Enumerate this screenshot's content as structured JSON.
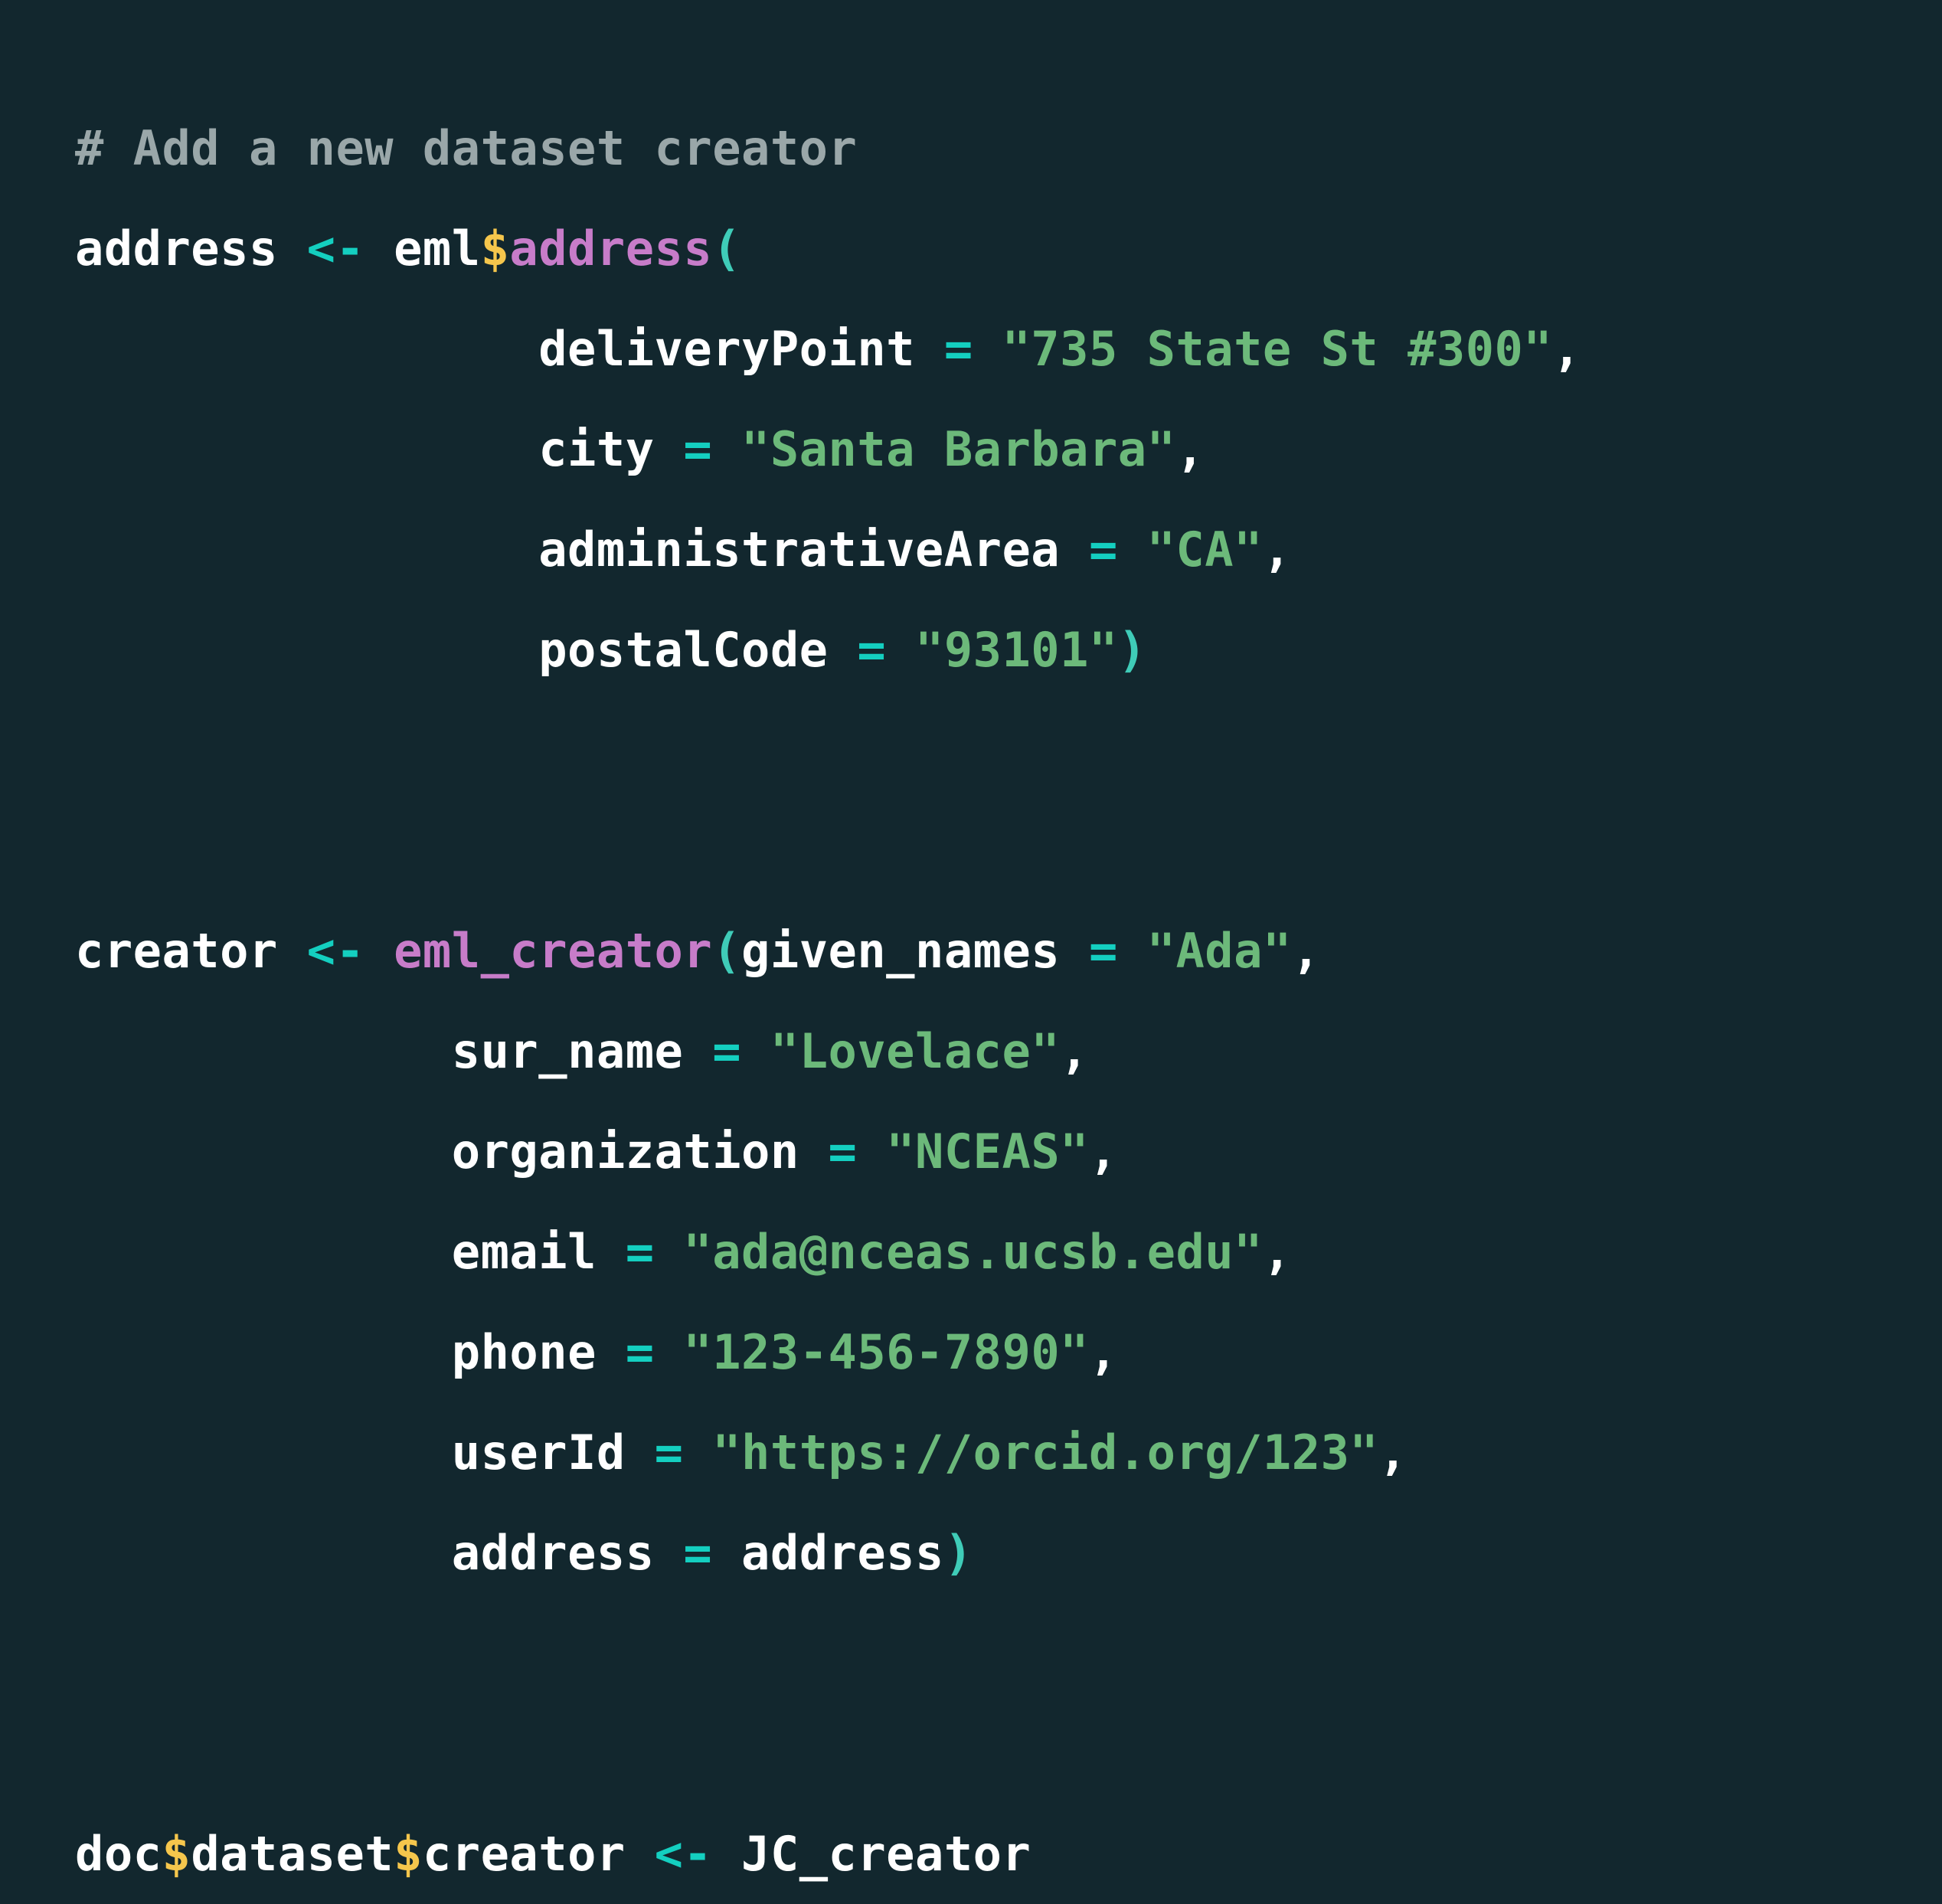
{
  "editor": {
    "language": "R",
    "background_color": "#12272e",
    "theme_name": "dark",
    "colors": {
      "comment": "#9aa7a9",
      "variable": "#ffffff",
      "assign_operator": "#14cfc0",
      "equals_operator": "#14cfc0",
      "dollar_operator": "#f5c64c",
      "function_name": "#c77cc9",
      "parenthesis": "#3fccb8",
      "string": "#6cb97a",
      "punctuation": "#ffffff"
    }
  },
  "code": {
    "lines": [
      {
        "id": "line-1",
        "kind": "comment",
        "text": "# Add a new dataset creator",
        "tokens": [
          {
            "t": "# Add a new dataset creator",
            "c": "comment"
          }
        ]
      },
      {
        "id": "line-2",
        "kind": "assignment",
        "text": "address <- eml$address(",
        "tokens": [
          {
            "t": "address",
            "c": "var"
          },
          {
            "t": " ",
            "c": "plain"
          },
          {
            "t": "<-",
            "c": "assign"
          },
          {
            "t": " ",
            "c": "plain"
          },
          {
            "t": "eml",
            "c": "var"
          },
          {
            "t": "$",
            "c": "dollar"
          },
          {
            "t": "address",
            "c": "func"
          },
          {
            "t": "(",
            "c": "paren"
          }
        ]
      },
      {
        "id": "line-3",
        "kind": "argument",
        "text": "                deliveryPoint = \"735 State St #300\",",
        "tokens": [
          {
            "t": "                ",
            "c": "plain"
          },
          {
            "t": "deliveryPoint",
            "c": "arg"
          },
          {
            "t": " ",
            "c": "plain"
          },
          {
            "t": "=",
            "c": "eq"
          },
          {
            "t": " ",
            "c": "plain"
          },
          {
            "t": "\"735 State St #300\"",
            "c": "string"
          },
          {
            "t": ",",
            "c": "punct"
          }
        ]
      },
      {
        "id": "line-4",
        "kind": "argument",
        "text": "                city = \"Santa Barbara\",",
        "tokens": [
          {
            "t": "                ",
            "c": "plain"
          },
          {
            "t": "city",
            "c": "arg"
          },
          {
            "t": " ",
            "c": "plain"
          },
          {
            "t": "=",
            "c": "eq"
          },
          {
            "t": " ",
            "c": "plain"
          },
          {
            "t": "\"Santa Barbara\"",
            "c": "string"
          },
          {
            "t": ",",
            "c": "punct"
          }
        ]
      },
      {
        "id": "line-5",
        "kind": "argument",
        "text": "                administrativeArea = \"CA\",",
        "tokens": [
          {
            "t": "                ",
            "c": "plain"
          },
          {
            "t": "administrativeArea",
            "c": "arg"
          },
          {
            "t": " ",
            "c": "plain"
          },
          {
            "t": "=",
            "c": "eq"
          },
          {
            "t": " ",
            "c": "plain"
          },
          {
            "t": "\"CA\"",
            "c": "string"
          },
          {
            "t": ",",
            "c": "punct"
          }
        ]
      },
      {
        "id": "line-6",
        "kind": "argument",
        "text": "                postalCode = \"93101\")",
        "tokens": [
          {
            "t": "                ",
            "c": "plain"
          },
          {
            "t": "postalCode",
            "c": "arg"
          },
          {
            "t": " ",
            "c": "plain"
          },
          {
            "t": "=",
            "c": "eq"
          },
          {
            "t": " ",
            "c": "plain"
          },
          {
            "t": "\"93101\"",
            "c": "string"
          },
          {
            "t": ")",
            "c": "paren"
          }
        ]
      },
      {
        "id": "line-7",
        "kind": "blank",
        "text": "",
        "tokens": []
      },
      {
        "id": "line-8",
        "kind": "blank",
        "text": "",
        "tokens": []
      },
      {
        "id": "line-9",
        "kind": "assignment",
        "text": "creator <- eml_creator(given_names = \"Ada\",",
        "tokens": [
          {
            "t": "creator",
            "c": "var"
          },
          {
            "t": " ",
            "c": "plain"
          },
          {
            "t": "<-",
            "c": "assign"
          },
          {
            "t": " ",
            "c": "plain"
          },
          {
            "t": "eml_creator",
            "c": "func"
          },
          {
            "t": "(",
            "c": "paren"
          },
          {
            "t": "given_names",
            "c": "arg"
          },
          {
            "t": " ",
            "c": "plain"
          },
          {
            "t": "=",
            "c": "eq"
          },
          {
            "t": " ",
            "c": "plain"
          },
          {
            "t": "\"Ada\"",
            "c": "string"
          },
          {
            "t": ",",
            "c": "punct"
          }
        ]
      },
      {
        "id": "line-10",
        "kind": "argument",
        "text": "             sur_name = \"Lovelace\",",
        "tokens": [
          {
            "t": "             ",
            "c": "plain"
          },
          {
            "t": "sur_name",
            "c": "arg"
          },
          {
            "t": " ",
            "c": "plain"
          },
          {
            "t": "=",
            "c": "eq"
          },
          {
            "t": " ",
            "c": "plain"
          },
          {
            "t": "\"Lovelace\"",
            "c": "string"
          },
          {
            "t": ",",
            "c": "punct"
          }
        ]
      },
      {
        "id": "line-11",
        "kind": "argument",
        "text": "             organization = \"NCEAS\",",
        "tokens": [
          {
            "t": "             ",
            "c": "plain"
          },
          {
            "t": "organization",
            "c": "arg"
          },
          {
            "t": " ",
            "c": "plain"
          },
          {
            "t": "=",
            "c": "eq"
          },
          {
            "t": " ",
            "c": "plain"
          },
          {
            "t": "\"NCEAS\"",
            "c": "string"
          },
          {
            "t": ",",
            "c": "punct"
          }
        ]
      },
      {
        "id": "line-12",
        "kind": "argument",
        "text": "             email = \"ada@nceas.ucsb.edu\",",
        "tokens": [
          {
            "t": "             ",
            "c": "plain"
          },
          {
            "t": "email",
            "c": "arg"
          },
          {
            "t": " ",
            "c": "plain"
          },
          {
            "t": "=",
            "c": "eq"
          },
          {
            "t": " ",
            "c": "plain"
          },
          {
            "t": "\"ada@nceas.ucsb.edu\"",
            "c": "string"
          },
          {
            "t": ",",
            "c": "punct"
          }
        ]
      },
      {
        "id": "line-13",
        "kind": "argument",
        "text": "             phone = \"123-456-7890\",",
        "tokens": [
          {
            "t": "             ",
            "c": "plain"
          },
          {
            "t": "phone",
            "c": "arg"
          },
          {
            "t": " ",
            "c": "plain"
          },
          {
            "t": "=",
            "c": "eq"
          },
          {
            "t": " ",
            "c": "plain"
          },
          {
            "t": "\"123-456-7890\"",
            "c": "string"
          },
          {
            "t": ",",
            "c": "punct"
          }
        ]
      },
      {
        "id": "line-14",
        "kind": "argument",
        "text": "             userId = \"https://orcid.org/123\",",
        "tokens": [
          {
            "t": "             ",
            "c": "plain"
          },
          {
            "t": "userId",
            "c": "arg"
          },
          {
            "t": " ",
            "c": "plain"
          },
          {
            "t": "=",
            "c": "eq"
          },
          {
            "t": " ",
            "c": "plain"
          },
          {
            "t": "\"https://orcid.org/123\"",
            "c": "string"
          },
          {
            "t": ",",
            "c": "punct"
          }
        ]
      },
      {
        "id": "line-15",
        "kind": "argument",
        "text": "             address = address)",
        "tokens": [
          {
            "t": "             ",
            "c": "plain"
          },
          {
            "t": "address",
            "c": "arg"
          },
          {
            "t": " ",
            "c": "plain"
          },
          {
            "t": "=",
            "c": "eq"
          },
          {
            "t": " ",
            "c": "plain"
          },
          {
            "t": "address",
            "c": "var"
          },
          {
            "t": ")",
            "c": "paren"
          }
        ]
      },
      {
        "id": "line-16",
        "kind": "blank",
        "text": "",
        "tokens": []
      },
      {
        "id": "line-17",
        "kind": "blank",
        "text": "",
        "tokens": []
      },
      {
        "id": "line-18",
        "kind": "assignment",
        "text": "doc$dataset$creator <- JC_creator",
        "tokens": [
          {
            "t": "doc",
            "c": "var"
          },
          {
            "t": "$",
            "c": "dollar"
          },
          {
            "t": "dataset",
            "c": "var"
          },
          {
            "t": "$",
            "c": "dollar"
          },
          {
            "t": "creator",
            "c": "var"
          },
          {
            "t": " ",
            "c": "plain"
          },
          {
            "t": "<-",
            "c": "assign"
          },
          {
            "t": " ",
            "c": "plain"
          },
          {
            "t": "JC_creator",
            "c": "var"
          }
        ]
      }
    ]
  }
}
